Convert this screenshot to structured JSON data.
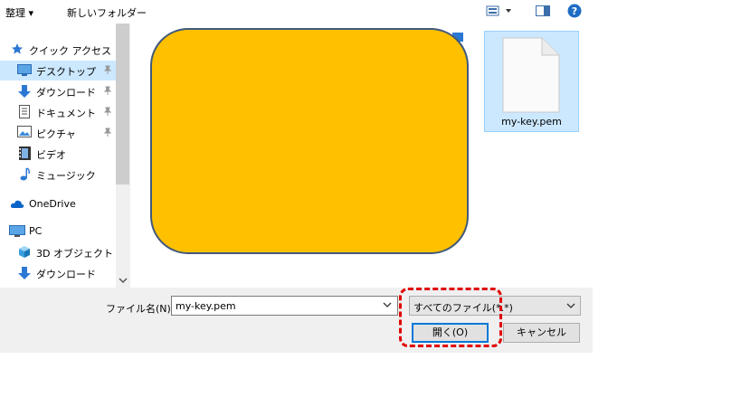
{
  "toolbar": {
    "organize_label": "整理 ▾",
    "new_folder_label": "新しいフォルダー",
    "view_icon": "view-icon",
    "help_icon": "help-icon"
  },
  "sidebar": {
    "items": [
      {
        "label": "クイック アクセス",
        "icon": "star-icon"
      },
      {
        "label": "デスクトップ",
        "icon": "desktop-icon"
      },
      {
        "label": "ダウンロード",
        "icon": "download-arrow-icon"
      },
      {
        "label": "ドキュメント",
        "icon": "document-icon"
      },
      {
        "label": "ピクチャ",
        "icon": "picture-icon"
      },
      {
        "label": "ビデオ",
        "icon": "video-icon"
      },
      {
        "label": "ミュージック",
        "icon": "music-icon"
      },
      {
        "label": "OneDrive",
        "icon": "cloud-icon"
      },
      {
        "label": "PC",
        "icon": "pc-icon"
      },
      {
        "label": "3D オブジェクト",
        "icon": "cube-icon"
      },
      {
        "label": "ダウンロード",
        "icon": "download-arrow-icon"
      }
    ]
  },
  "main": {
    "file": {
      "name": "my-key.pem",
      "icon": "file-icon"
    }
  },
  "bottom": {
    "filename_label": "ファイル名(N):",
    "filename_value": "my-key.pem",
    "filetype_value": "すべてのファイル(*.*)",
    "open_label": "開く(O)",
    "cancel_label": "キャンセル"
  },
  "colors": {
    "selection": "#cce8ff",
    "accent": "#0078d7",
    "highlight_border": "#e00000",
    "overlay_fill": "#ffc000"
  }
}
